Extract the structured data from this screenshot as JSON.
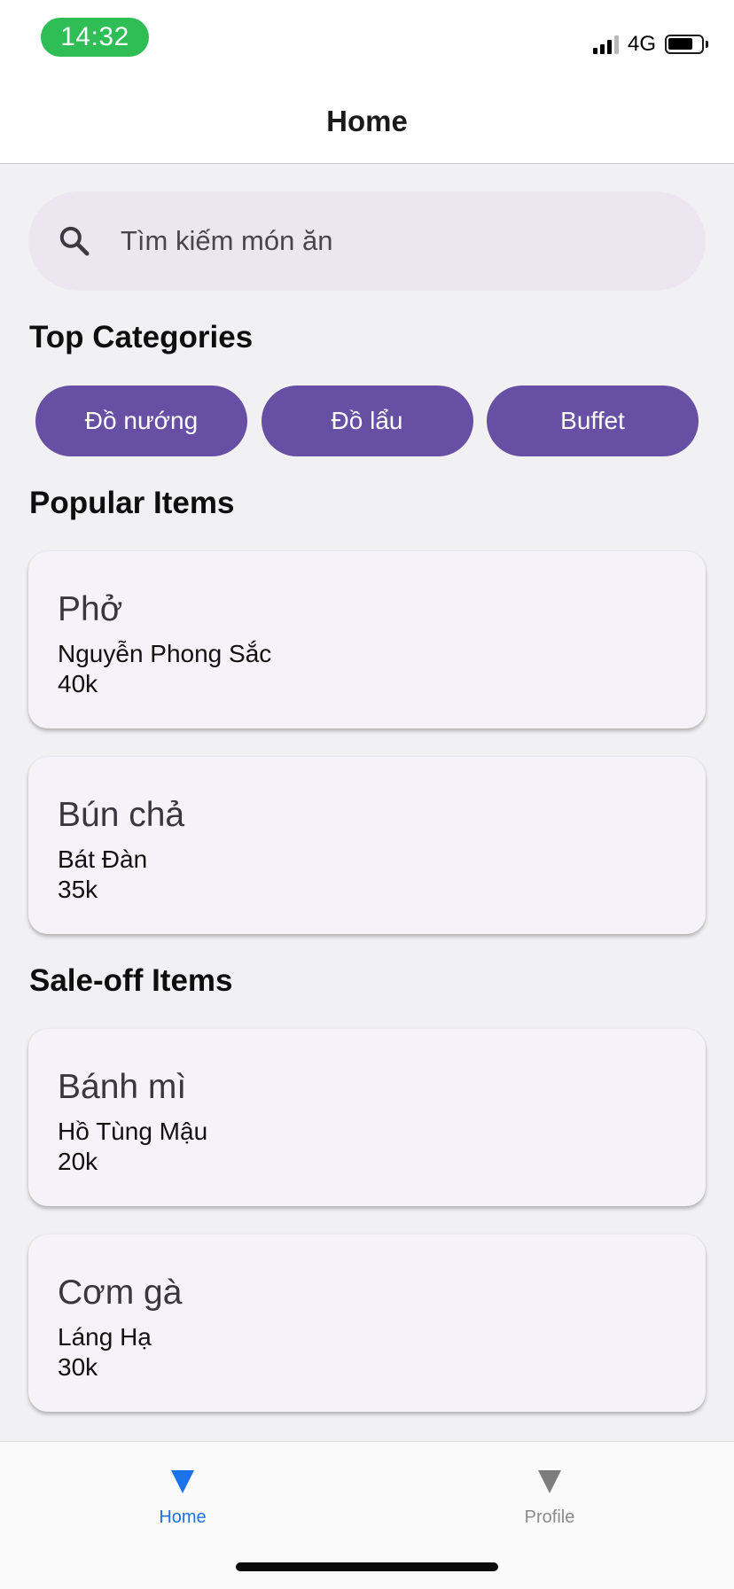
{
  "status_bar": {
    "time": "14:32",
    "network": "4G",
    "icons": [
      "signal-icon",
      "battery-icon"
    ]
  },
  "app_bar": {
    "title": "Home"
  },
  "search": {
    "placeholder": "Tìm kiếm món ăn",
    "icon": "search-icon"
  },
  "sections": {
    "top_categories": "Top Categories",
    "popular_items": "Popular Items",
    "sale_off_items": "Sale-off Items"
  },
  "categories": [
    {
      "label": "Đồ nướng"
    },
    {
      "label": "Đồ lẩu"
    },
    {
      "label": "Buffet"
    }
  ],
  "popular_items": [
    {
      "name": "Phở",
      "place": "Nguyễn Phong Sắc",
      "price": "40k"
    },
    {
      "name": "Bún chả",
      "place": "Bát Đàn",
      "price": "35k"
    }
  ],
  "sale_off_items": [
    {
      "name": "Bánh mì",
      "place": "Hồ Tùng Mậu",
      "price": "20k"
    },
    {
      "name": "Cơm gà",
      "place": "Láng Hạ",
      "price": "30k"
    }
  ],
  "tabs": [
    {
      "label": "Home",
      "active": true
    },
    {
      "label": "Profile",
      "active": false
    }
  ],
  "colors": {
    "accent": "#6750a4",
    "search_bg": "#ece6f0",
    "card_bg": "#f6f2f9",
    "active_tab": "#1a73e8",
    "time_pill": "#2fbe55"
  }
}
